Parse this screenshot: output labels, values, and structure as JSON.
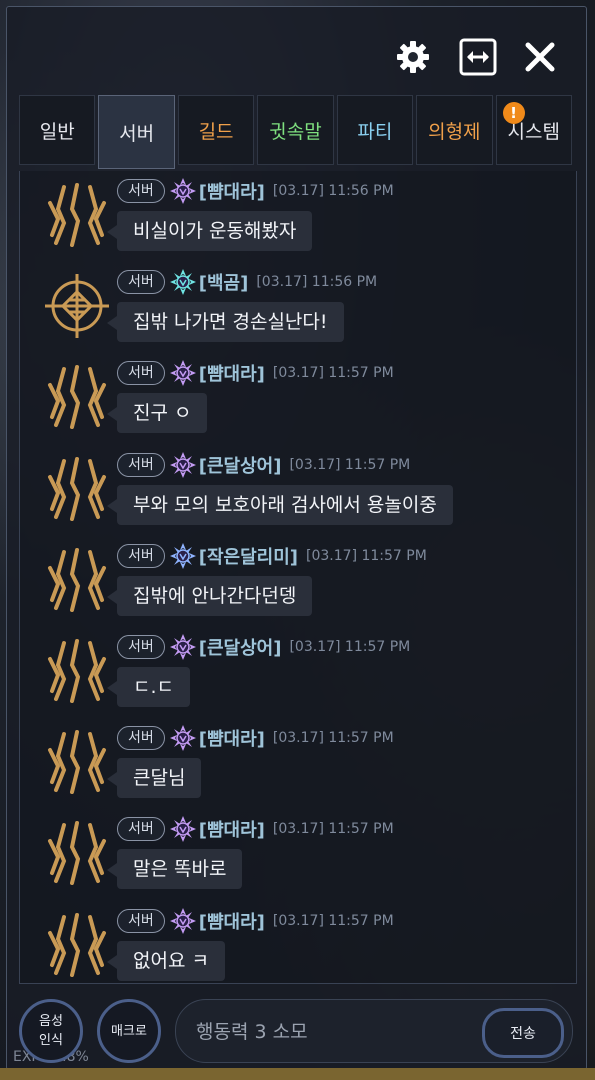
{
  "toolbar": {
    "settings_icon": "gear-icon",
    "resize_icon": "horizontal-resize-icon",
    "close_icon": "close-icon"
  },
  "tabs": [
    {
      "label": "일반",
      "color": "#e6e8ee"
    },
    {
      "label": "서버",
      "color": "#e6e8ee",
      "active": true
    },
    {
      "label": "길드",
      "color": "#f0a04a"
    },
    {
      "label": "귓속말",
      "color": "#7fe07f"
    },
    {
      "label": "파티",
      "color": "#8ad0f0"
    },
    {
      "label": "의형제",
      "color": "#f0a04a"
    },
    {
      "label": "시스템",
      "color": "#e6e8ee",
      "badge": "!"
    }
  ],
  "messages": [
    {
      "channel": "서버",
      "name": "[뺨대라]",
      "time": "[03.17] 11:56 PM",
      "text": "비실이가 운동해봤자",
      "avatar": "gold-claw-emblem",
      "rank": "purple-rank-icon"
    },
    {
      "channel": "서버",
      "name": "[백곰]",
      "time": "[03.17] 11:56 PM",
      "text": "집밖 나가면 경손실난다!",
      "avatar": "gold-knot-emblem",
      "rank": "teal-rank-icon"
    },
    {
      "channel": "서버",
      "name": "[뺨대라]",
      "time": "[03.17] 11:57 PM",
      "text": "진구 ㅇ",
      "avatar": "gold-claw-emblem",
      "rank": "purple-rank-icon"
    },
    {
      "channel": "서버",
      "name": "[큰달상어]",
      "time": "[03.17] 11:57 PM",
      "text": "부와 모의 보호아래 검사에서 용놀이중",
      "avatar": "gold-claw-emblem",
      "rank": "purple-rank-icon"
    },
    {
      "channel": "서버",
      "name": "[작은달리미]",
      "time": "[03.17] 11:57 PM",
      "text": "집밖에 안나간다던뎅",
      "avatar": "gold-claw-emblem",
      "rank": "blue-rank-icon"
    },
    {
      "channel": "서버",
      "name": "[큰달상어]",
      "time": "[03.17] 11:57 PM",
      "text": "ㄷ.ㄷ",
      "avatar": "gold-claw-emblem",
      "rank": "purple-rank-icon"
    },
    {
      "channel": "서버",
      "name": "[뺨대라]",
      "time": "[03.17] 11:57 PM",
      "text": "큰달님",
      "avatar": "gold-claw-emblem",
      "rank": "purple-rank-icon"
    },
    {
      "channel": "서버",
      "name": "[뺨대라]",
      "time": "[03.17] 11:57 PM",
      "text": "말은 똑바로",
      "avatar": "gold-claw-emblem",
      "rank": "purple-rank-icon"
    },
    {
      "channel": "서버",
      "name": "[뺨대라]",
      "time": "[03.17] 11:57 PM",
      "text": "없어요 ㅋ",
      "avatar": "gold-claw-emblem",
      "rank": "purple-rank-icon"
    }
  ],
  "bottom": {
    "voice_label_1": "음성",
    "voice_label_2": "인식",
    "macro_label": "매크로",
    "input_placeholder": "행동력 3 소모",
    "send_label": "전송",
    "exp_text": "EXP 34.8%"
  }
}
